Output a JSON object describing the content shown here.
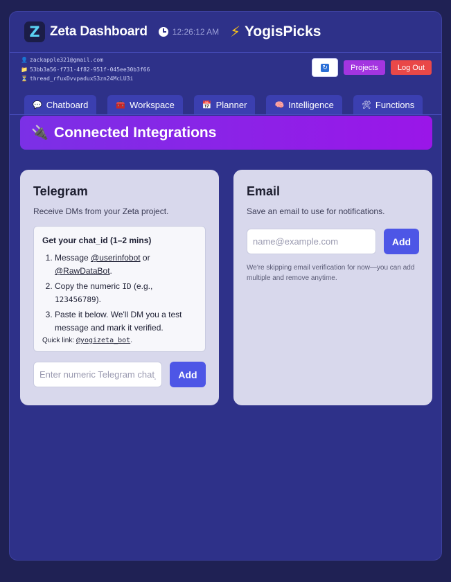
{
  "header": {
    "logo_letter": "Z",
    "title": "Zeta Dashboard",
    "time": "12:26:12 AM",
    "brand": "YogisPicks"
  },
  "meta": {
    "email": "zackapple321@gmail.com",
    "project_id": "53bb3a56-f731-4f82-951f-045ee30b3f66",
    "thread_id": "thread_rfuxDvvpaduxS3zn24McLU3i"
  },
  "actions": {
    "projects_label": "Projects",
    "logout_label": "Log Out"
  },
  "tabs": [
    {
      "icon": "chat-icon",
      "label": "Chatboard"
    },
    {
      "icon": "toolbox-icon",
      "label": "Workspace"
    },
    {
      "icon": "calendar-icon",
      "label": "Planner"
    },
    {
      "icon": "brain-icon",
      "label": "Intelligence"
    },
    {
      "icon": "tools-icon",
      "label": "Functions"
    }
  ],
  "banner": {
    "title": "Connected Integrations"
  },
  "telegram": {
    "title": "Telegram",
    "description": "Receive DMs from your Zeta project.",
    "steps_title": "Get your chat_id (1–2 mins)",
    "step1_prefix": "Message ",
    "step1_bot1": "@userinfobot",
    "step1_mid": " or",
    "step1_bot2": "@RawDataBot",
    "step1_suffix": ".",
    "step2_prefix": "Copy the numeric ",
    "step2_code": "ID",
    "step2_mid": " (e.g.,",
    "step2_example": "123456789",
    "step2_suffix": ").",
    "step3": "Paste it below. We'll DM you a test message and mark it verified.",
    "quick_prefix": "Quick link: ",
    "quick_link": "@yogizeta_bot",
    "quick_suffix": ".",
    "input_placeholder": "Enter numeric Telegram chat_id",
    "add_label": "Add"
  },
  "email": {
    "title": "Email",
    "description": "Save an email to use for notifications.",
    "input_placeholder": "name@example.com",
    "add_label": "Add",
    "note": "We're skipping email verification for now—you can add multiple and remove anytime."
  }
}
